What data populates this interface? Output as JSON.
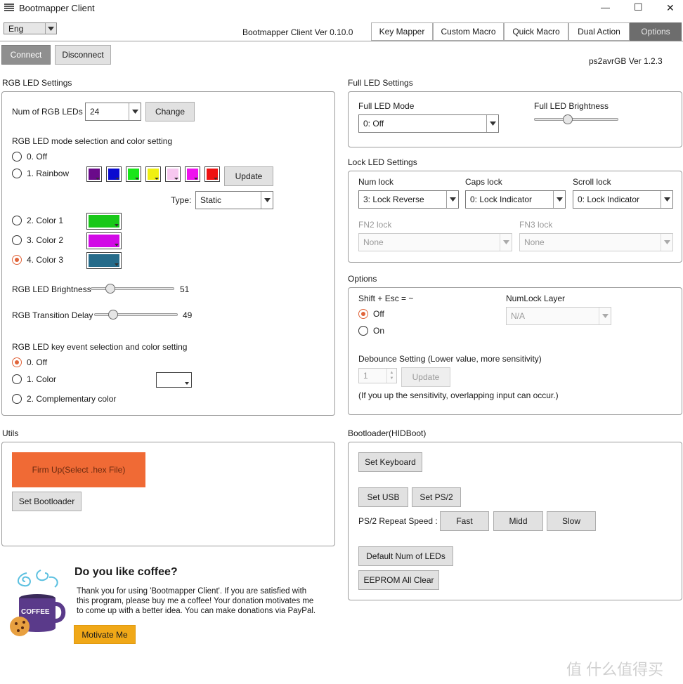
{
  "window": {
    "title": "Bootmapper Client",
    "minimize": "—",
    "maximize": "☐",
    "close": "✕"
  },
  "header": {
    "language": "Eng",
    "version": "Bootmapper Client Ver 0.10.0",
    "tabs": [
      "Key Mapper",
      "Custom Macro",
      "Quick Macro",
      "Dual Action",
      "Options"
    ],
    "active_tab": "Options",
    "connect": "Connect",
    "disconnect": "Disconnect",
    "fw_version": "ps2avrGB  Ver 1.2.3"
  },
  "rgb": {
    "title": "RGB LED Settings",
    "num_label": "Num of RGB LEDs",
    "num_value": "24",
    "change": "Change",
    "mode_label": "RGB LED mode selection and color setting",
    "modes": [
      "0. Off",
      "1. Rainbow",
      "2. Color 1",
      "3. Color 2",
      "4. Color 3"
    ],
    "selected_mode": "4. Color 3",
    "rainbow_colors": [
      "#6a0a8a",
      "#0a0ad0",
      "#19e619",
      "#f0f012",
      "#f7c7f0",
      "#ee12ee",
      "#ee1212"
    ],
    "update": "Update",
    "type_label": "Type:",
    "type_value": "Static",
    "color1": "#19c819",
    "color2": "#d20ae6",
    "color3": "#256b8a",
    "brightness_label": "RGB LED Brightness",
    "brightness_value": "51",
    "brightness_fraction": 0.2,
    "delay_label": "RGB Transition Delay",
    "delay_value": "49",
    "delay_fraction": 0.22,
    "key_label": "RGB LED key event selection and color setting",
    "key_modes": [
      "0. Off",
      "1. Color",
      "2. Complementary color"
    ],
    "selected_key_mode": "0. Off",
    "key_color": "#ffffff"
  },
  "full_led": {
    "title": "Full LED Settings",
    "mode_label": "Full LED Mode",
    "mode_value": "0: Off",
    "brightness_label": "Full LED Brightness",
    "brightness_fraction": 0.4
  },
  "lock_led": {
    "title": "Lock LED Settings",
    "num_label": "Num lock",
    "num_value": "3: Lock Reverse",
    "caps_label": "Caps lock",
    "caps_value": "0: Lock Indicator",
    "scroll_label": "Scroll lock",
    "scroll_value": "0: Lock Indicator",
    "fn2_label": "FN2 lock",
    "fn2_value": "None",
    "fn3_label": "FN3 lock",
    "fn3_value": "None"
  },
  "options": {
    "title": "Options",
    "shift_label": "Shift + Esc = ~",
    "shift_modes": [
      "Off",
      "On"
    ],
    "selected_shift": "Off",
    "numlock_label": "NumLock Layer",
    "numlock_value": "N/A",
    "debounce_label": "Debounce Setting (Lower value, more sensitivity)",
    "debounce_value": "1",
    "debounce_update": "Update",
    "debounce_note": "(If you up the sensitivity, overlapping input can occur.)"
  },
  "utils": {
    "title": "Utils",
    "firmup": "Firm Up(Select .hex File)",
    "firmup_color": "#f06a35",
    "set_bootloader": "Set Bootloader"
  },
  "bootloader": {
    "title": "Bootloader(HIDBoot)",
    "set_keyboard": "Set Keyboard",
    "set_usb": "Set USB",
    "set_ps2": "Set PS/2",
    "repeat_label": "PS/2 Repeat Speed :",
    "fast": "Fast",
    "midd": "Midd",
    "slow": "Slow",
    "default_leds": "Default Num of LEDs",
    "eeprom_clear": "EEPROM All Clear"
  },
  "coffee": {
    "heading": "Do you like coffee?",
    "line1": "Thank you for using 'Bootmapper Client'. If you are satisfied with",
    "line2": "this program, please buy me a coffee! Your donation motivates me",
    "line3": "to come up with a better idea. You can make donations via PayPal.",
    "mug_text": "COFFEE",
    "button": "Motivate Me"
  },
  "watermark": "值 什么值得买"
}
